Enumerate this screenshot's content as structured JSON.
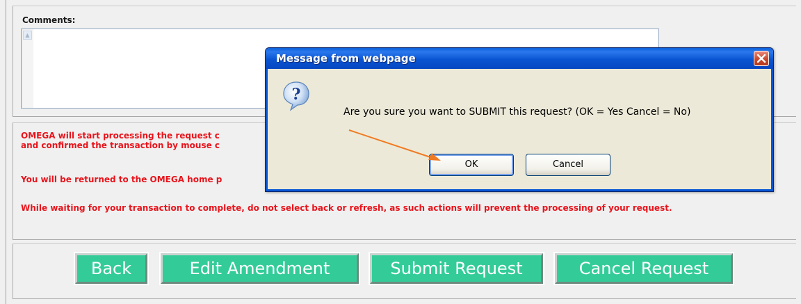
{
  "form": {
    "comments_label": "Comments:",
    "comments_value": "",
    "info_lines": [
      "OMEGA will start processing the request c",
      "and confirmed the transaction by mouse c",
      "You will be returned to the OMEGA home p",
      "While waiting for your transaction to complete, do not select back or refresh, as such actions will prevent the processing of your request."
    ],
    "buttons": {
      "back": "Back",
      "edit_amendment": "Edit Amendment",
      "submit_request": "Submit Request",
      "cancel_request": "Cancel Request"
    },
    "button_color": "#33cc99",
    "warning_color": "#e8141c"
  },
  "dialog": {
    "title": "Message from webpage",
    "message": "Are you sure you want to SUBMIT this request? (OK = Yes   Cancel = No)",
    "ok_label": "OK",
    "cancel_label": "Cancel",
    "icon": "question-icon",
    "close_icon": "close-icon",
    "titlebar_color": "#0a54d1"
  },
  "annotation": {
    "type": "arrow",
    "color": "#f07a22",
    "points_to": "dialog-ok-button"
  }
}
